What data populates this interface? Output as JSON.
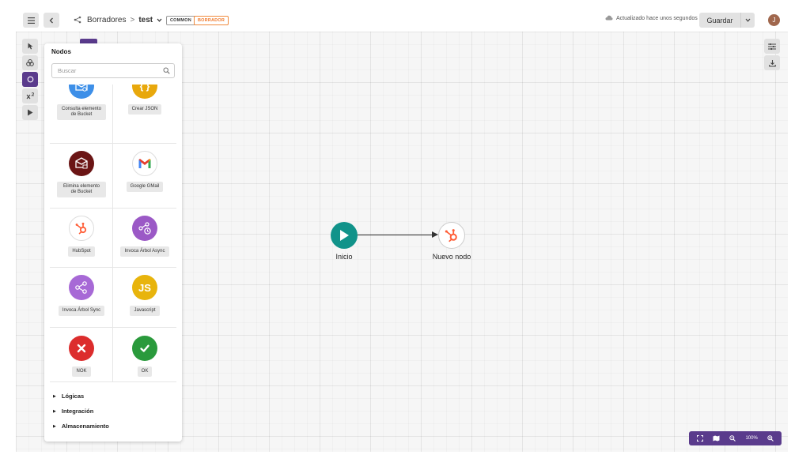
{
  "topbar": {
    "menu_icon": "hamburger-icon",
    "back_icon": "chevron-left-icon",
    "breadcrumb": {
      "parent": "Borradores",
      "separator": ">",
      "current": "test"
    },
    "badges": {
      "common": "COMMON",
      "borrador": "BORRADOR"
    },
    "status_text": "Actualizado hace unos segundos",
    "save_label": "Guardar",
    "avatar_initial": "J"
  },
  "panel": {
    "title": "Nodos",
    "search_placeholder": "Buscar",
    "nodes": [
      {
        "label": "Consulta elemento de Bucket",
        "icon": "bucket-search-icon",
        "color": "#3d8fe8"
      },
      {
        "label": "Crear JSON",
        "icon": "json-braces-icon",
        "color": "#e8a80c"
      },
      {
        "label": "Elimina elemento de Bucket",
        "icon": "bucket-delete-icon",
        "color": "#6b1515"
      },
      {
        "label": "Google GMail",
        "icon": "gmail-icon",
        "color": "#ffffff"
      },
      {
        "label": "HubSpot",
        "icon": "hubspot-icon",
        "color": "#ffffff"
      },
      {
        "label": "Invoca Árbol Async",
        "icon": "tree-async-icon",
        "color": "#9b59c6"
      },
      {
        "label": "Invoca Árbol Sync",
        "icon": "tree-sync-icon",
        "color": "#a769d6"
      },
      {
        "label": "Javascript",
        "icon": "js-icon",
        "color": "#e8b40c"
      },
      {
        "label": "NOK",
        "icon": "x-icon",
        "color": "#dc2d2d"
      },
      {
        "label": "OK",
        "icon": "check-icon",
        "color": "#2a9a3c"
      }
    ],
    "categories": [
      "Lógicas",
      "Integración",
      "Almacenamiento"
    ]
  },
  "flow": {
    "start_label": "Inicio",
    "new_node_label": "Nuevo nodo",
    "start_color": "#11938a",
    "accent": "#5a3b8c"
  },
  "zoom": {
    "level": "100%"
  }
}
